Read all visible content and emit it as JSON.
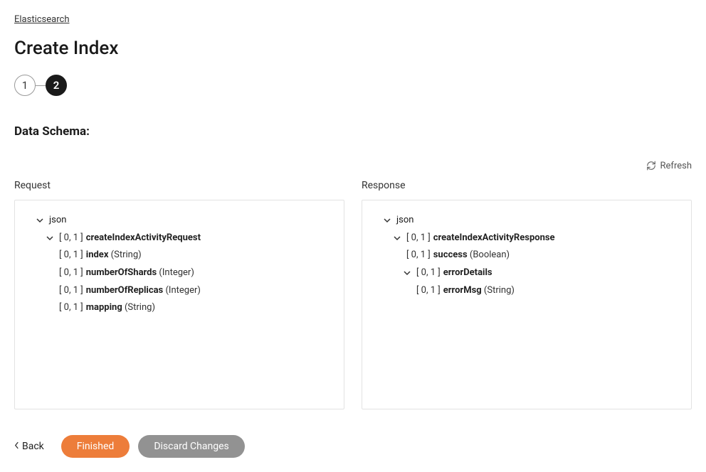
{
  "breadcrumb": {
    "link_text": "Elasticsearch"
  },
  "page_title": "Create Index",
  "stepper": {
    "step1": "1",
    "step2": "2"
  },
  "section_title": "Data Schema:",
  "refresh_label": "Refresh",
  "request": {
    "label": "Request",
    "root": "json",
    "card_root": "[ 0, 1 ]",
    "root_field": "createIndexActivityRequest",
    "fields": [
      {
        "card": "[ 0, 1 ]",
        "name": "index",
        "type": "(String)"
      },
      {
        "card": "[ 0, 1 ]",
        "name": "numberOfShards",
        "type": "(Integer)"
      },
      {
        "card": "[ 0, 1 ]",
        "name": "numberOfReplicas",
        "type": "(Integer)"
      },
      {
        "card": "[ 0, 1 ]",
        "name": "mapping",
        "type": "(String)"
      }
    ]
  },
  "response": {
    "label": "Response",
    "root": "json",
    "card_root": "[ 0, 1 ]",
    "root_field": "createIndexActivityResponse",
    "success": {
      "card": "[ 0, 1 ]",
      "name": "success",
      "type": "(Boolean)"
    },
    "errorDetails": {
      "card": "[ 0, 1 ]",
      "name": "errorDetails"
    },
    "errorMsg": {
      "card": "[ 0, 1 ]",
      "name": "errorMsg",
      "type": "(String)"
    }
  },
  "footer": {
    "back": "Back",
    "finished": "Finished",
    "discard": "Discard Changes"
  }
}
